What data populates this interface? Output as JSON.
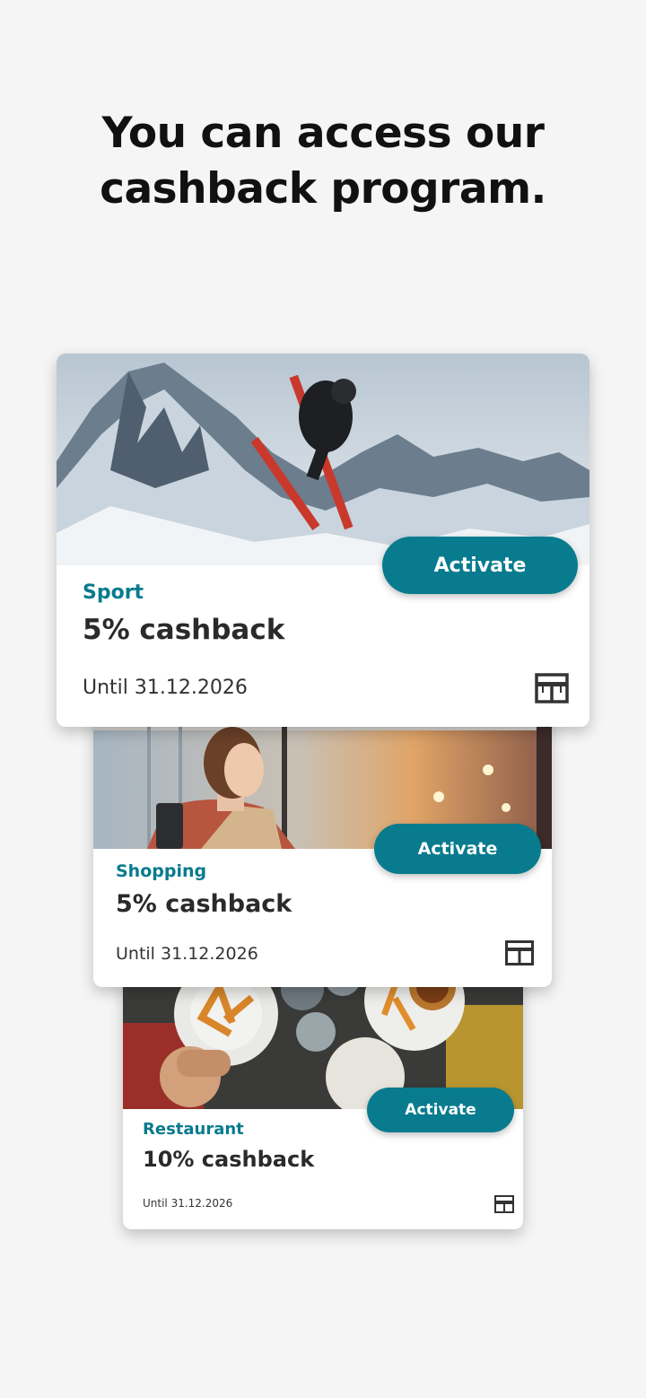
{
  "headline": {
    "line1": "You can access our",
    "line2": "cashback program."
  },
  "cards": [
    {
      "category": "Sport",
      "cashback": "5% cashback",
      "until": "Until 31.12.2026",
      "activate_label": "Activate",
      "image": "skier-mountains",
      "icon": "store-icon"
    },
    {
      "category": "Shopping",
      "cashback": "5% cashback",
      "until": "Until 31.12.2026",
      "activate_label": "Activate",
      "image": "woman-shopping",
      "icon": "store-icon"
    },
    {
      "category": "Restaurant",
      "cashback": "10% cashback",
      "until": "Until 31.12.2026",
      "activate_label": "Activate",
      "image": "food-table",
      "icon": "store-icon"
    }
  ],
  "colors": {
    "accent": "#087b8e",
    "background": "#f5f5f5",
    "card": "#ffffff"
  }
}
